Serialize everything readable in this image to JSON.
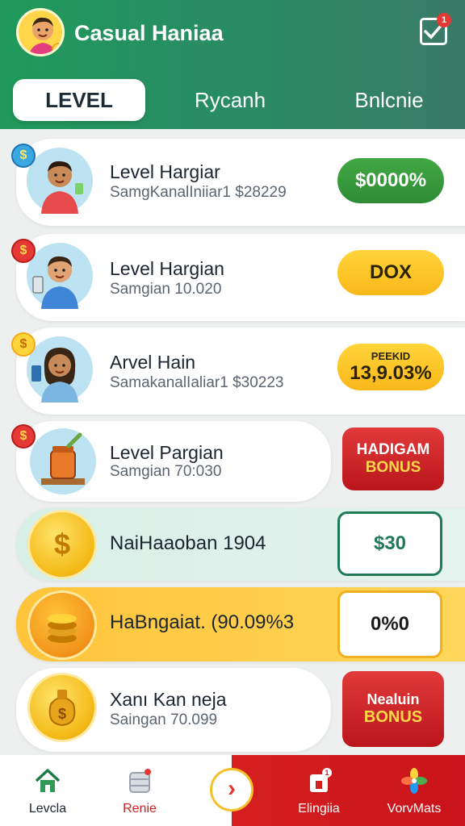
{
  "header": {
    "title": "Casual Haniaa",
    "notification_count": "1",
    "tabs": [
      {
        "label": "LEVEL",
        "active": true
      },
      {
        "label": "Rycanh",
        "active": false
      },
      {
        "label": "Bnlcnie",
        "active": false
      }
    ]
  },
  "rows": [
    {
      "title": "Level Hargiar",
      "subtitle": "SamgKanalIniiar1 $28229",
      "action": "$0000%",
      "style": "green",
      "avatar": "boy-with-items-icon",
      "tag": "coin-blue-icon"
    },
    {
      "title": "Level Hargian",
      "subtitle": "Samgian 10.020",
      "action": "DOX",
      "style": "yellow",
      "avatar": "boy-with-phone-icon",
      "tag": "coin-red-icon"
    },
    {
      "title": "Arvel Hain",
      "subtitle": "SamakanalIaliar1 $30223",
      "action_small": "PEEKID",
      "action": "13,9.03%",
      "style": "yellow",
      "avatar": "girl-with-phone-icon",
      "tag": "coin-gold-icon"
    },
    {
      "title": "Level Pargian",
      "subtitle": "Samgian 70:030",
      "badge_line1": "HADIGAM",
      "badge_line2": "BONUS",
      "style": "red-badge",
      "avatar": "jar-icon",
      "tag": "coin-red-icon"
    },
    {
      "title": "NaiHaaoban 1904",
      "action": "$30",
      "style": "outline-green",
      "avatar": "coin-bag-icon"
    },
    {
      "title": "HaBngaiat. (90.09%3",
      "action": "0%0",
      "style": "outline-yellow",
      "avatar": "coin-stack-icon"
    },
    {
      "title": "Xanı Kan neja",
      "subtitle": "Saingan 70.099",
      "badge_line1": "Nealuin",
      "badge_line2": "BONUS",
      "style": "red-badge",
      "avatar": "money-bag-icon"
    }
  ],
  "nav": {
    "items": [
      {
        "label": "Levcla",
        "icon": "home-icon"
      },
      {
        "label": "Renie",
        "icon": "coin-jar-icon"
      },
      {
        "label": "",
        "icon": "chevron-right-icon"
      },
      {
        "label": "Elingiia",
        "icon": "gift-icon",
        "badge": "1"
      },
      {
        "label": "VorvMats",
        "icon": "pinwheel-icon"
      }
    ]
  },
  "colors": {
    "header_green": "#1f9a5b",
    "accent_red": "#d51f1f",
    "accent_yellow": "#ffc43a",
    "pill_green": "#3a9a3e"
  }
}
